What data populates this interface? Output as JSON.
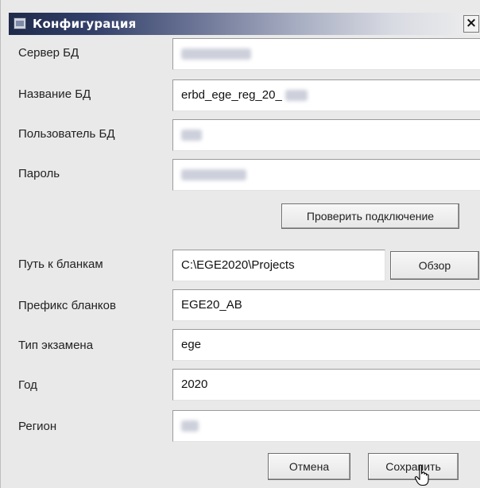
{
  "window": {
    "title": "Конфигурация",
    "close_label": "×"
  },
  "fields": {
    "db_server": {
      "label": "Сервер БД",
      "value": ""
    },
    "db_name": {
      "label": "Название БД",
      "value": "erbd_ege_reg_20_"
    },
    "db_user": {
      "label": "Пользователь БД",
      "value": ""
    },
    "password": {
      "label": "Пароль",
      "value": ""
    },
    "forms_path": {
      "label": "Путь к бланкам",
      "value": "C:\\EGE2020\\Projects"
    },
    "forms_prefix": {
      "label": "Префикс бланков",
      "value": "EGE20_AB"
    },
    "exam_type": {
      "label": "Тип экзамена",
      "value": "ege"
    },
    "year": {
      "label": "Год",
      "value": "2020"
    },
    "region": {
      "label": "Регион",
      "value": ""
    }
  },
  "buttons": {
    "test_connection": "Проверить подключение",
    "browse": "Обзор",
    "cancel": "Отмена",
    "save": "Сохранить"
  },
  "icons": {
    "window_icon": "app-window-icon",
    "close": "close-icon",
    "cursor": "hand-cursor-icon"
  },
  "colors": {
    "titlebar_start": "#1f2a4a",
    "window_bg": "#e9e9e9",
    "field_bg": "#ffffff"
  }
}
